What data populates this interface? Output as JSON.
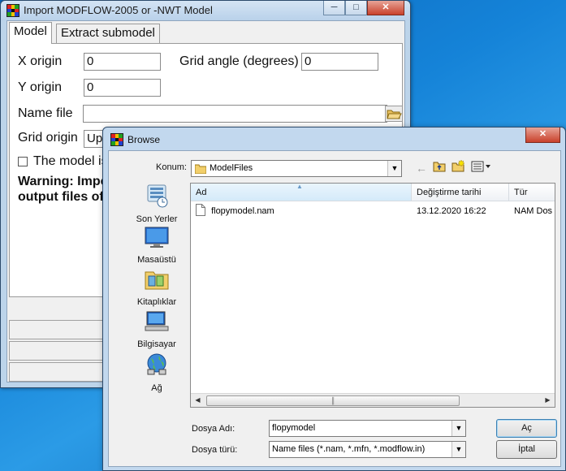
{
  "main_window": {
    "title": "Import MODFLOW-2005 or -NWT Model",
    "tabs": [
      {
        "label": "Model"
      },
      {
        "label": "Extract submodel"
      }
    ],
    "fields": {
      "x_origin_label": "X origin",
      "x_origin_value": "0",
      "y_origin_label": "Y origin",
      "y_origin_value": "0",
      "grid_angle_label": "Grid angle (degrees)",
      "grid_angle_value": "0",
      "name_file_label": "Name file",
      "name_file_value": "",
      "grid_origin_label": "Grid origin",
      "grid_origin_value": "Up"
    },
    "checkbox_label": "The model is",
    "warning_line1": "Warning: Impo",
    "warning_line2": "output files of"
  },
  "browse_dialog": {
    "title": "Browse",
    "location_label": "Konum:",
    "location_value": "ModelFiles",
    "places": [
      {
        "label": "Son Yerler",
        "icon": "recent-places-icon"
      },
      {
        "label": "Masaüstü",
        "icon": "desktop-icon"
      },
      {
        "label": "Kitaplıklar",
        "icon": "libraries-icon"
      },
      {
        "label": "Bilgisayar",
        "icon": "computer-icon"
      },
      {
        "label": "Ağ",
        "icon": "network-icon"
      }
    ],
    "columns": [
      "Ad",
      "Değiştirme tarihi",
      "Tür"
    ],
    "files": [
      {
        "name": "flopymodel.nam",
        "modified": "13.12.2020 16:22",
        "type": "NAM Dos"
      }
    ],
    "filename_label": "Dosya Adı:",
    "filename_value": "flopymodel",
    "filetype_label": "Dosya türü:",
    "filetype_value": "Name files (*.nam, *.mfn, *.modflow.in)",
    "open_button": "Aç",
    "cancel_button": "İptal"
  }
}
